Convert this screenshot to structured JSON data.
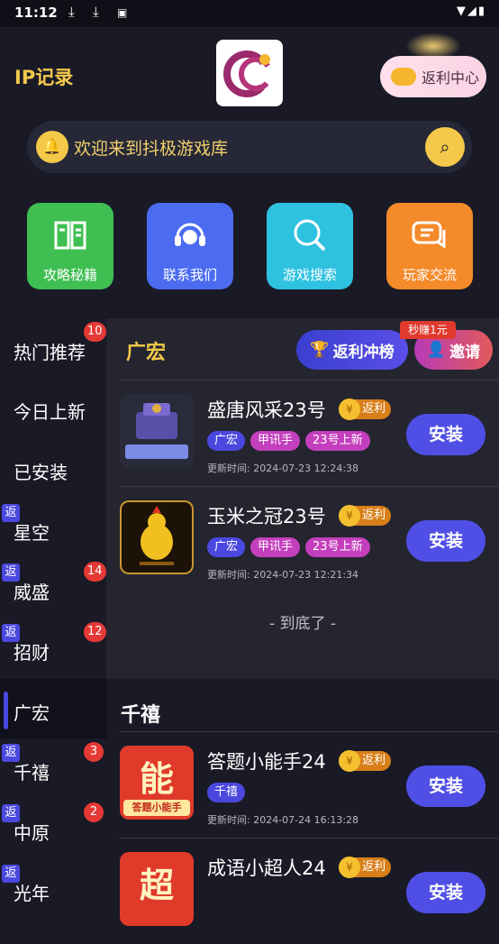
{
  "status": {
    "time": "11:12"
  },
  "header": {
    "ip_label": "IP记录",
    "rebate_center": "返利中心"
  },
  "search": {
    "placeholder_text": "欢迎来到抖极游戏库"
  },
  "quick_actions": [
    {
      "label": "攻略秘籍",
      "icon": "book-icon",
      "color": "#3fbf52"
    },
    {
      "label": "联系我们",
      "icon": "headset-icon",
      "color": "#4b6cf0"
    },
    {
      "label": "游戏搜索",
      "icon": "search-icon",
      "color": "#2fc2e0"
    },
    {
      "label": "玩家交流",
      "icon": "chat-icon",
      "color": "#f58a2a"
    }
  ],
  "sidebar": {
    "items": [
      {
        "label": "热门推荐",
        "badge": "10",
        "fan": ""
      },
      {
        "label": "今日上新",
        "badge": "",
        "fan": ""
      },
      {
        "label": "已安装",
        "badge": "",
        "fan": ""
      },
      {
        "label": "星空",
        "badge": "",
        "fan": "返"
      },
      {
        "label": "威盛",
        "badge": "14",
        "fan": "返"
      },
      {
        "label": "招财",
        "badge": "12",
        "fan": "返"
      },
      {
        "label": "广宏",
        "badge": "",
        "fan": ""
      },
      {
        "label": "千禧",
        "badge": "3",
        "fan": "返"
      },
      {
        "label": "中原",
        "badge": "2",
        "fan": "返"
      },
      {
        "label": "光年",
        "badge": "",
        "fan": "返"
      }
    ]
  },
  "section1": {
    "title": "广宏",
    "rank_button": "返利冲榜",
    "invite_button": "邀请",
    "earn_tag": "秒赚1元",
    "games": [
      {
        "name": "盛唐风采23号",
        "rebate": "返利",
        "tags": [
          "广宏",
          "甲讯手",
          "23号上新"
        ],
        "updated": "更新时间: 2024-07-23 12:24:38",
        "install": "安装"
      },
      {
        "name": "玉米之冠23号",
        "rebate": "返利",
        "tags": [
          "广宏",
          "甲讯手",
          "23号上新"
        ],
        "updated": "更新时间: 2024-07-23 12:21:34",
        "install": "安装"
      }
    ],
    "end_text": "- 到底了 -"
  },
  "section2": {
    "title": "千禧",
    "games": [
      {
        "name": "答题小能手24",
        "rebate": "返利",
        "tags": [
          "千禧"
        ],
        "updated": "更新时间: 2024-07-24 16:13:28",
        "install": "安装",
        "icon_text": "能",
        "icon_sub": "答题小能手"
      },
      {
        "name": "成语小超人24",
        "rebate": "返利",
        "tags": [],
        "updated": "",
        "install": "安装",
        "icon_text": "超"
      }
    ]
  }
}
